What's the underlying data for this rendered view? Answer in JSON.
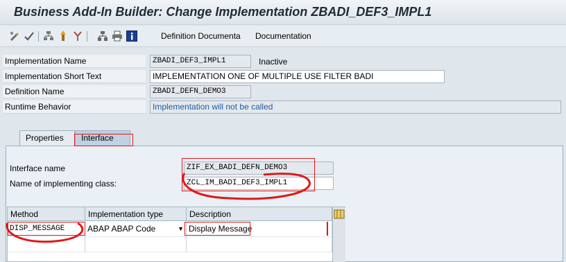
{
  "window": {
    "title": "Business Add-In Builder: Change Implementation ZBADI_DEF3_IMPL1"
  },
  "toolbar": {
    "icons": [
      "toggle-display-change-icon",
      "check-icon",
      "activate-icon",
      "deactivate-icon",
      "where-used-icon",
      "hierarchy-icon",
      "print-icon",
      "information-icon"
    ],
    "definition_doc_label": "Definition Documenta",
    "documentation_label": "Documentation"
  },
  "header": {
    "impl_name_label": "Implementation Name",
    "impl_name_value": "ZBADI_DEF3_IMPL1",
    "impl_status": "Inactive",
    "short_text_label": "Implementation Short Text",
    "short_text_value": "IMPLEMENTATION ONE OF MULTIPLE USE FILTER BADI",
    "def_name_label": "Definition Name",
    "def_name_value": "ZBADI_DEFN_DEMO3",
    "runtime_label": "Runtime Behavior",
    "runtime_value": "Implementation will not be called"
  },
  "tabs": [
    {
      "label": "Properties",
      "active": false
    },
    {
      "label": "Interface",
      "active": true
    }
  ],
  "interface_tab": {
    "interface_name_label": "Interface name",
    "interface_name_value": "ZIF_EX_BADI_DEFN_DEMO3",
    "impl_class_label": "Name of implementing class:",
    "impl_class_value": "ZCL_IM_BADI_DEF3_IMPL1"
  },
  "methods_table": {
    "columns": [
      "Method",
      "Implementation type",
      "Description"
    ],
    "rows": [
      {
        "method": "DISP_MESSAGE",
        "impl_type": "ABAP ABAP Code",
        "description": "Display Message"
      }
    ]
  },
  "colors": {
    "annotation": "#e01818",
    "runtime_text": "#1c5a9c",
    "panel_bg": "#eaf0f5"
  }
}
